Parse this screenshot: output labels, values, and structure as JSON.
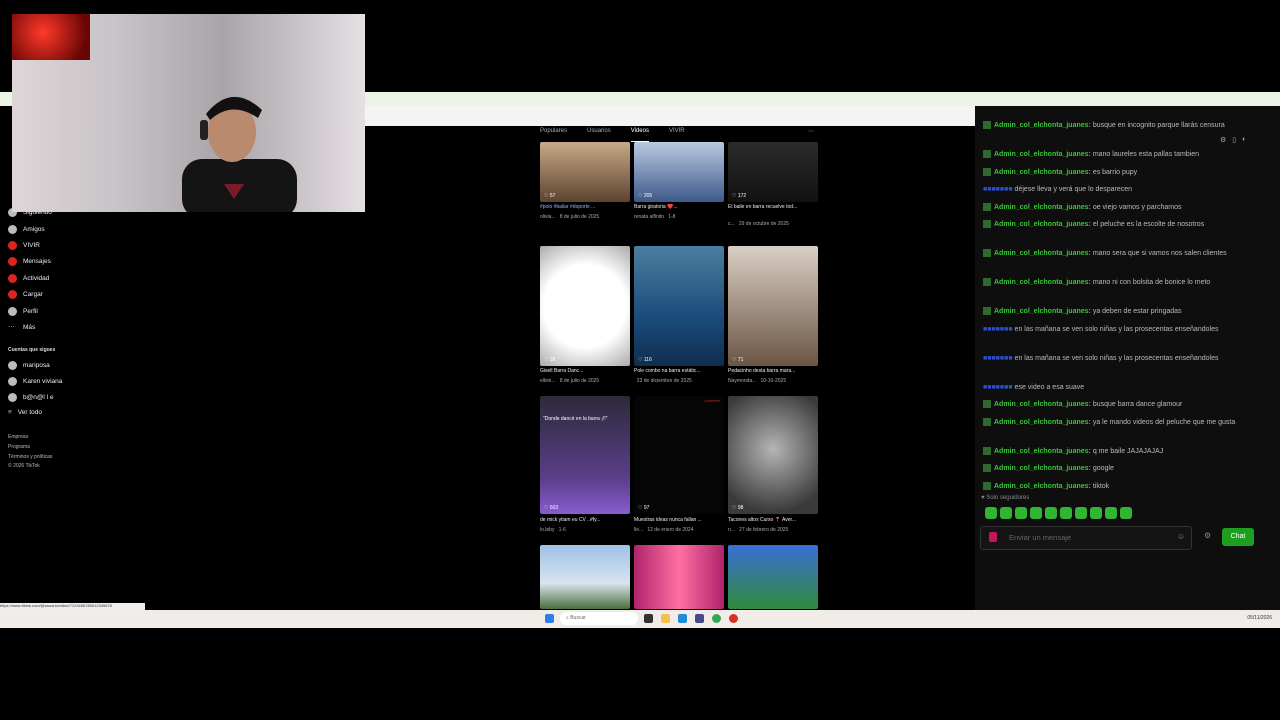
{
  "tabs": [
    {
      "label": "Populares"
    },
    {
      "label": "Usuarios"
    },
    {
      "label": "Videos"
    },
    {
      "label": "VIVIR"
    }
  ],
  "sidebar": {
    "items": [
      {
        "label": "Siguiendo"
      },
      {
        "label": "Amigos"
      },
      {
        "label": "VIVIR"
      },
      {
        "label": "Mensajes"
      },
      {
        "label": "Actividad"
      },
      {
        "label": "Cargar"
      },
      {
        "label": "Perfil"
      },
      {
        "label": "Más"
      }
    ],
    "following_heading": "Cuentas que sigues",
    "following": [
      {
        "label": "mariposa"
      },
      {
        "label": "Karen viviana"
      },
      {
        "label": "b@n@l l e"
      }
    ],
    "see_all": "Ver todo",
    "footer": [
      "Empresa",
      "Programa",
      "Términos y políticas",
      "© 2026 TikTok"
    ]
  },
  "videos": [
    {
      "likes": "57",
      "title": "#polo #bailar #doporte ...",
      "user": "olivia...",
      "date": "8 de julio de 2025"
    },
    {
      "likes": "205",
      "title": "Barra giratoria ❤️...",
      "user": "renata alfinito",
      "date": "1-8"
    },
    {
      "likes": "172",
      "title": "El baile en barra recuelve tod...",
      "user": "c...",
      "date": "29 de octubre de 2025"
    },
    {
      "likes": "38",
      "title": "Gisell Barra Danc...",
      "user": "elkini...",
      "date": "8 de julio de 2025"
    },
    {
      "likes": "116",
      "title": "Pole combo na barra estátic...",
      "user": "",
      "date": "23 de diciembre de 2025"
    },
    {
      "likes": "71",
      "title": "Pedacinho desta barra mara...",
      "user": "Naymonda...",
      "date": "10-10-2025"
    },
    {
      "likes": "603",
      "title": "de mick ytiam eu CV ..#fy...",
      "user": "lo.biby",
      "date": "1-6"
    },
    {
      "likes": "97",
      "title": "Muestras ideas nunca fallan ...",
      "user": "lle...",
      "date": "12 de enero de 2024"
    },
    {
      "likes": "98",
      "title": "Tacones altos Curso 📍 Aver...",
      "user": "n...",
      "date": "27 de febrero de 2025"
    }
  ],
  "thumb_caption": "\"Donde dancé en la barra ¡!!\"",
  "thumb_badge": "pinterest",
  "chat": {
    "messages": [
      {
        "user": "Admin_col_elchonta_juanes:",
        "text": "busque en incognito parque llarás censura"
      },
      {
        "user": "Admin_col_elchonta_juanes:",
        "text": "mano laureles esta pallas tambien"
      },
      {
        "user": "Admin_col_elchonta_juanes:",
        "text": "es barrio pupy"
      },
      {
        "user": "",
        "text": "déjese lleva y verá que lo desparecen",
        "alt": true
      },
      {
        "user": "Admin_col_elchonta_juanes:",
        "text": "oe viejo vamos y parchamos"
      },
      {
        "user": "Admin_col_elchonta_juanes:",
        "text": "el peluche es la escolte de nosotros"
      },
      {
        "user": "Admin_col_elchonta_juanes:",
        "text": "mano sera que si vamos nos salen clientes"
      },
      {
        "user": "Admin_col_elchonta_juanes:",
        "text": "mano ni con bolsita de bonice lo meto"
      },
      {
        "user": "Admin_col_elchonta_juanes:",
        "text": "ya deben de estar pringadas"
      },
      {
        "user": "",
        "text": "en las mañana se ven solo niñas y las prosecentas enseñandoles",
        "alt": true
      },
      {
        "user": "",
        "text": "en las mañana se ven solo niñas y las prosecentas enseñandoles",
        "alt": true
      },
      {
        "user": "",
        "text": "ese video a esa suave",
        "alt": true
      },
      {
        "user": "Admin_col_elchonta_juanes:",
        "text": "busque barra dance glamour"
      },
      {
        "user": "Admin_col_elchonta_juanes:",
        "text": "ya le mando videos del peluche que me gusta"
      },
      {
        "user": "Admin_col_elchonta_juanes:",
        "text": "q me baile JAJAJAJAJ"
      },
      {
        "user": "Admin_col_elchonta_juanes:",
        "text": "google"
      },
      {
        "user": "Admin_col_elchonta_juanes:",
        "text": "tiktok"
      }
    ],
    "only_subs": "Solo seguidores",
    "input_placeholder": "Enviar un mensaje",
    "send_label": "Chat"
  },
  "status_url": "https://www.tiktok.com/@usuario/video/7123456789012345678",
  "taskbar": {
    "search_label": "Buscar",
    "clock": "05/11/2026"
  },
  "colors": {
    "chat_user": "#39c639",
    "accent_red": "#d22222",
    "send_button": "#1e9e1e"
  }
}
